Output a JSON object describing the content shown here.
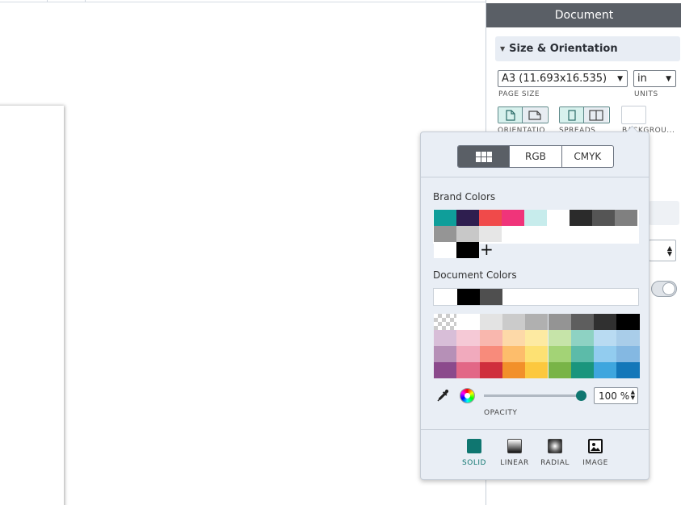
{
  "panel": {
    "title": "Document",
    "section_title": "Size & Orientation",
    "page_size": {
      "value": "A3 (11.693x16.535)",
      "label": "PAGE SIZE"
    },
    "units": {
      "value": "in",
      "label": "UNITS"
    },
    "orientation_label": "ORIENTATIO",
    "spreads_label": "SPREADS",
    "background_label": "BACKGROU...",
    "background_color": "#ffffff"
  },
  "color_picker": {
    "tabs": [
      {
        "label": "",
        "icon": "grid-icon",
        "active": true
      },
      {
        "label": "RGB",
        "active": false
      },
      {
        "label": "CMYK",
        "active": false
      }
    ],
    "brand_colors_label": "Brand Colors",
    "brand_colors": [
      "#0f9e9a",
      "#2e1e4f",
      "#f04a4a",
      "#f0347a",
      "#c7ecec",
      "#ffffff",
      "#2b2b2b",
      "#555555",
      "#808080",
      "#959595",
      "#c8c8c8",
      "#e6e6e6",
      "#ffffff",
      "#000000"
    ],
    "add_color_symbol": "+",
    "document_colors_label": "Document Colors",
    "document_colors": [
      "#ffffff",
      "#000000",
      "#4f4f4f"
    ],
    "palette": [
      [
        "transparent",
        "#ffffff",
        "#e3e3e3",
        "#cbcbcb",
        "#b0b0b0",
        "#949494",
        "#5e5e5e",
        "#303030",
        "#000000"
      ],
      [
        "#d8bed8",
        "#f5c9d6",
        "#f9b7ae",
        "#fdd9a8",
        "#fdeaa2",
        "#c6e4a9",
        "#8ed2c3",
        "#b9dbf2",
        "#a9cde9"
      ],
      [
        "#b690b7",
        "#f1aabd",
        "#f88b7b",
        "#fdbd6b",
        "#fde173",
        "#a3d376",
        "#5cbba9",
        "#92ccef",
        "#84b8e2"
      ],
      [
        "#8b4a8c",
        "#e26786",
        "#cf2e3c",
        "#f2902a",
        "#fcc83e",
        "#79b447",
        "#1a957d",
        "#3ea6de",
        "#1377b9"
      ]
    ],
    "opacity": {
      "value": "100 %",
      "label": "OPACITY",
      "percent": 100
    },
    "fill_types": [
      {
        "label": "SOLID",
        "icon": "solid-fill-icon",
        "active": true
      },
      {
        "label": "LINEAR",
        "icon": "linear-gradient-icon",
        "active": false
      },
      {
        "label": "RADIAL",
        "icon": "radial-gradient-icon",
        "active": false
      },
      {
        "label": "IMAGE",
        "icon": "image-fill-icon",
        "active": false
      }
    ],
    "accent_color": "#0f7670"
  }
}
